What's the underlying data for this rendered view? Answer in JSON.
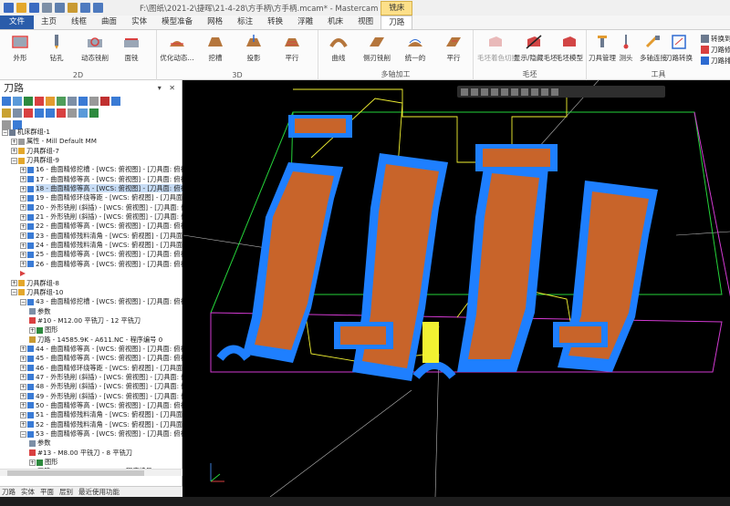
{
  "title": "F:\\图纸\\2021-2\\捷晖\\21-4-28\\方手柄\\方手柄.mcam* - Mastercam 铣...",
  "context_tab": "铣床",
  "tabs": [
    "文件",
    "主页",
    "线框",
    "曲面",
    "实体",
    "模型准备",
    "网格",
    "标注",
    "转换",
    "浮雕",
    "机床",
    "视图",
    "刀路"
  ],
  "ribbon": {
    "groups": [
      {
        "label": "2D",
        "buttons": [
          "外形",
          "钻孔",
          "动态铣削",
          "面铣"
        ]
      },
      {
        "label": "3D",
        "buttons": [
          "优化动态...",
          "挖槽",
          "投影",
          "平行"
        ]
      },
      {
        "label": "多轴加工",
        "buttons": [
          "曲线",
          "侧刃铣削",
          "统一的",
          "平行"
        ]
      },
      {
        "label": "毛坯",
        "buttons": [
          "毛坯着色切换",
          "显示/隐藏毛坯",
          "毛坯模型"
        ]
      },
      {
        "label": "工具",
        "buttons": [
          "刀具管理",
          "测头",
          "多轴连接",
          "刀路转换"
        ]
      }
    ],
    "small_buttons": [
      "转换到五轴",
      "刀路修剪",
      "刀路排版"
    ]
  },
  "panel": {
    "title": "刀路",
    "controls": "▾ ✕",
    "bottom_tabs": [
      "刀路",
      "实体",
      "平面",
      "层别",
      "最近使用功能"
    ]
  },
  "tree": [
    {
      "indent": 0,
      "exp": "−",
      "icon": "machine",
      "text": "机床群组-1"
    },
    {
      "indent": 1,
      "exp": "+",
      "icon": "props",
      "text": "属性 - Mill Default MM"
    },
    {
      "indent": 1,
      "exp": "+",
      "icon": "group",
      "text": "刀具群组-7"
    },
    {
      "indent": 1,
      "exp": "−",
      "icon": "group",
      "text": "刀具群组-9"
    },
    {
      "indent": 2,
      "exp": "+",
      "icon": "op",
      "text": "16 - 曲面精修挖槽 - [WCS: 俯视图] - [刀具面: 俯视图]"
    },
    {
      "indent": 2,
      "exp": "+",
      "icon": "op",
      "text": "17 - 曲面精修等高 - [WCS: 俯视图] - [刀具面: 俯视图]"
    },
    {
      "indent": 2,
      "exp": "+",
      "icon": "op",
      "text": "18 - 曲面精修等高 - [WCS: 俯视图] - [刀具面: 俯视图]",
      "sel": true
    },
    {
      "indent": 2,
      "exp": "+",
      "icon": "op",
      "text": "19 - 曲面精修环绕等距 - [WCS: 俯视图] - [刀具面: 俯视"
    },
    {
      "indent": 2,
      "exp": "+",
      "icon": "op",
      "text": "20 - 外形铣削 (斜插) - [WCS: 俯视图] - [刀具面: 俯视"
    },
    {
      "indent": 2,
      "exp": "+",
      "icon": "op",
      "text": "21 - 外形铣削 (斜插) - [WCS: 俯视图] - [刀具面: 俯视"
    },
    {
      "indent": 2,
      "exp": "+",
      "icon": "op",
      "text": "22 - 曲面精修等高 - [WCS: 俯视图] - [刀具面: 俯视图]"
    },
    {
      "indent": 2,
      "exp": "+",
      "icon": "op",
      "text": "23 - 曲面精修残料清角 - [WCS: 俯视图] - [刀具面: 俯视"
    },
    {
      "indent": 2,
      "exp": "+",
      "icon": "op",
      "text": "24 - 曲面精修残料清角 - [WCS: 俯视图] - [刀具面: 俯视"
    },
    {
      "indent": 2,
      "exp": "+",
      "icon": "op",
      "text": "25 - 曲面精修等高 - [WCS: 俯视图] - [刀具面: 俯视图]"
    },
    {
      "indent": 2,
      "exp": "+",
      "icon": "op",
      "text": "26 - 曲面精修等高 - [WCS: 俯视图] - [刀具面: 俯视图]"
    },
    {
      "indent": 2,
      "exp": "",
      "icon": "marker",
      "text": ""
    },
    {
      "indent": 1,
      "exp": "+",
      "icon": "group",
      "text": "刀具群组-8"
    },
    {
      "indent": 1,
      "exp": "−",
      "icon": "group",
      "text": "刀具群组-10"
    },
    {
      "indent": 2,
      "exp": "−",
      "icon": "op",
      "text": "43 - 曲面精修挖槽 - [WCS: 俯视图] - [刀具面: 俯视图]"
    },
    {
      "indent": 3,
      "exp": "",
      "icon": "param",
      "text": "参数"
    },
    {
      "indent": 3,
      "exp": "",
      "icon": "tool",
      "text": "#10 - M12.00 平铣刀 - 12 平铣刀"
    },
    {
      "indent": 3,
      "exp": "+",
      "icon": "geom",
      "text": "图形"
    },
    {
      "indent": 3,
      "exp": "",
      "icon": "path",
      "text": "刀路 - 14585.9K - A611.NC - 程序编号 0"
    },
    {
      "indent": 2,
      "exp": "+",
      "icon": "op",
      "text": "44 - 曲面精修等高 - [WCS: 俯视图] - [刀具面: 俯视图]"
    },
    {
      "indent": 2,
      "exp": "+",
      "icon": "op",
      "text": "45 - 曲面精修等高 - [WCS: 俯视图] - [刀具面: 俯视图]"
    },
    {
      "indent": 2,
      "exp": "+",
      "icon": "op",
      "text": "46 - 曲面精修环绕等距 - [WCS: 俯视图] - [刀具面: 俯视"
    },
    {
      "indent": 2,
      "exp": "+",
      "icon": "op",
      "text": "47 - 外形铣削 (斜插) - [WCS: 俯视图] - [刀具面: 俯视"
    },
    {
      "indent": 2,
      "exp": "+",
      "icon": "op",
      "text": "48 - 外形铣削 (斜插) - [WCS: 俯视图] - [刀具面: 俯视"
    },
    {
      "indent": 2,
      "exp": "+",
      "icon": "op",
      "text": "49 - 外形铣削 (斜插) - [WCS: 俯视图] - [刀具面: 俯视"
    },
    {
      "indent": 2,
      "exp": "+",
      "icon": "op",
      "text": "50 - 曲面精修等高 - [WCS: 俯视图] - [刀具面: 俯视图]"
    },
    {
      "indent": 2,
      "exp": "+",
      "icon": "op",
      "text": "51 - 曲面精修残料清角 - [WCS: 俯视图] - [刀具面: 俯视"
    },
    {
      "indent": 2,
      "exp": "+",
      "icon": "op",
      "text": "52 - 曲面精修残料清角 - [WCS: 俯视图] - [刀具面: 俯视"
    },
    {
      "indent": 2,
      "exp": "−",
      "icon": "op",
      "text": "53 - 曲面精修等高 - [WCS: 俯视图] - [刀具面: 俯视图]"
    },
    {
      "indent": 3,
      "exp": "",
      "icon": "param",
      "text": "参数"
    },
    {
      "indent": 3,
      "exp": "",
      "icon": "tool",
      "text": "#13 - M8.00 平铣刀 - 8 平铣刀"
    },
    {
      "indent": 3,
      "exp": "+",
      "icon": "geom",
      "text": "图形"
    },
    {
      "indent": 3,
      "exp": "",
      "icon": "path",
      "text": "刀路 - 3704.8K - A617.NC - 程序编号 0"
    }
  ],
  "colors": {
    "ribbon_accent": "#2a5caa",
    "context_tab": "#fde08a",
    "part_copper": "#c8642a",
    "toolpath_blue": "#1e7fff",
    "boundary_green": "#25d43a",
    "boundary_magenta": "#d23ad2",
    "leadin_yellow": "#f2f232",
    "viewport_bg": "#000000"
  },
  "icons": {
    "machine": "machine-group-icon",
    "group": "folder-icon",
    "op": "operation-icon",
    "param": "parameters-icon",
    "tool": "tool-icon",
    "geom": "geometry-icon",
    "path": "toolpath-icon",
    "marker": "insert-arrow-icon"
  }
}
